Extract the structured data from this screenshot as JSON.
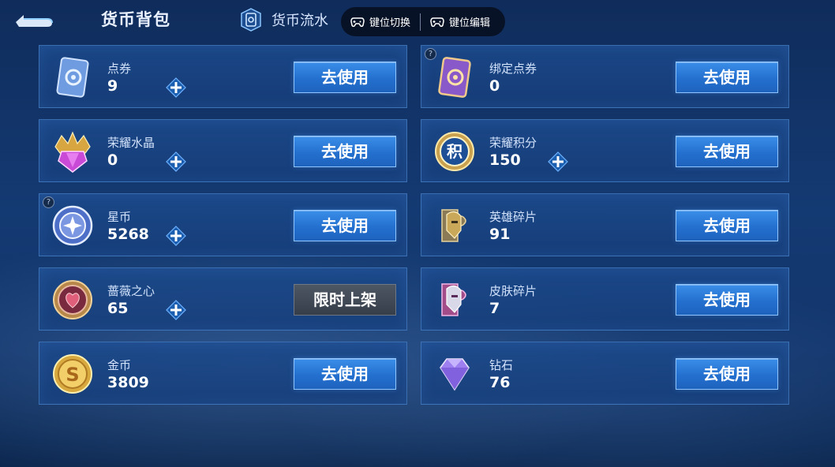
{
  "header": {
    "title": "货币背包",
    "flow_label": "货币流水",
    "key_switch_label": "键位切换",
    "key_edit_label": "键位编辑"
  },
  "colors": {
    "accent": "#2f86e6",
    "card_border": "#5a96dc",
    "limited_bg": "#3d4551"
  },
  "currencies": [
    {
      "name": "点券",
      "amount": "9",
      "action": "去使用",
      "icon": "ticket-card-icon",
      "has_plus": true,
      "has_help": false
    },
    {
      "name": "绑定点券",
      "amount": "0",
      "action": "去使用",
      "icon": "bound-ticket-card-icon",
      "has_plus": false,
      "has_help": true
    },
    {
      "name": "荣耀水晶",
      "amount": "0",
      "action": "去使用",
      "icon": "glory-crystal-icon",
      "has_plus": true,
      "has_help": false
    },
    {
      "name": "荣耀积分",
      "amount": "150",
      "action": "去使用",
      "icon": "glory-points-icon",
      "has_plus": true,
      "has_help": false,
      "badge_text": "积"
    },
    {
      "name": "星币",
      "amount": "5268",
      "action": "去使用",
      "icon": "star-coin-icon",
      "has_plus": true,
      "has_help": true
    },
    {
      "name": "英雄碎片",
      "amount": "91",
      "action": "去使用",
      "icon": "hero-fragment-icon",
      "has_plus": false,
      "has_help": false
    },
    {
      "name": "蔷薇之心",
      "amount": "65",
      "action": "限时上架",
      "icon": "rose-heart-icon",
      "has_plus": true,
      "has_help": false
    },
    {
      "name": "皮肤碎片",
      "amount": "7",
      "action": "去使用",
      "icon": "skin-fragment-icon",
      "has_plus": false,
      "has_help": false
    },
    {
      "name": "金币",
      "amount": "3809",
      "action": "去使用",
      "icon": "gold-coin-icon",
      "has_plus": false,
      "has_help": false,
      "badge_text": "S"
    },
    {
      "name": "钻石",
      "amount": "76",
      "action": "去使用",
      "icon": "diamond-icon",
      "has_plus": false,
      "has_help": false
    }
  ]
}
